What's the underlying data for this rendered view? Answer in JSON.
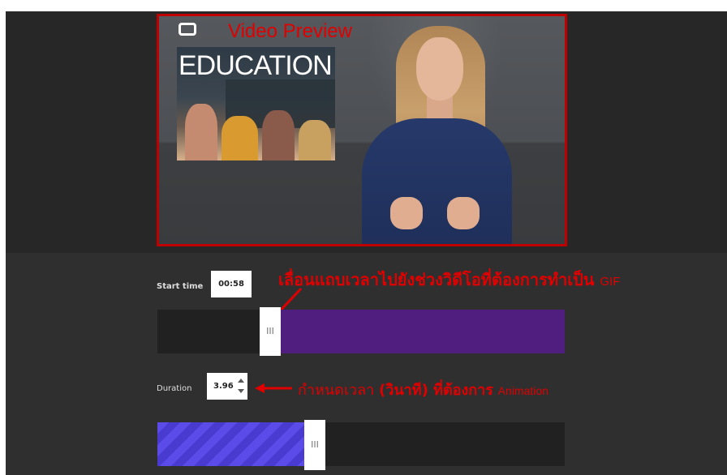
{
  "preview": {
    "label": "Video Preview",
    "overlay_title": "EDUCATION"
  },
  "start": {
    "label": "Start time",
    "value": "00:58",
    "handle_grip": "III",
    "position_fraction": 0.25
  },
  "duration": {
    "label": "Duration",
    "value": "3.96",
    "handle_grip": "III",
    "fill_fraction": 0.36
  },
  "annotations": {
    "start_note_main": "เลื่อนแถบเวลาไปยังช่วงวิดีโอที่ต้องการทำเป็น",
    "start_note_suffix": "GIF",
    "duration_note_prefix": "กำหนดเวลา",
    "duration_note_bold": "(วินาที) ที่ต้องการ",
    "duration_note_suffix": "Animation"
  },
  "colors": {
    "annotation_red": "#e00000",
    "range_purple": "#4f1e7f",
    "duration_blue": "#5b4be8"
  },
  "icons": {
    "preview_toggle": "fullscreen-icon"
  }
}
